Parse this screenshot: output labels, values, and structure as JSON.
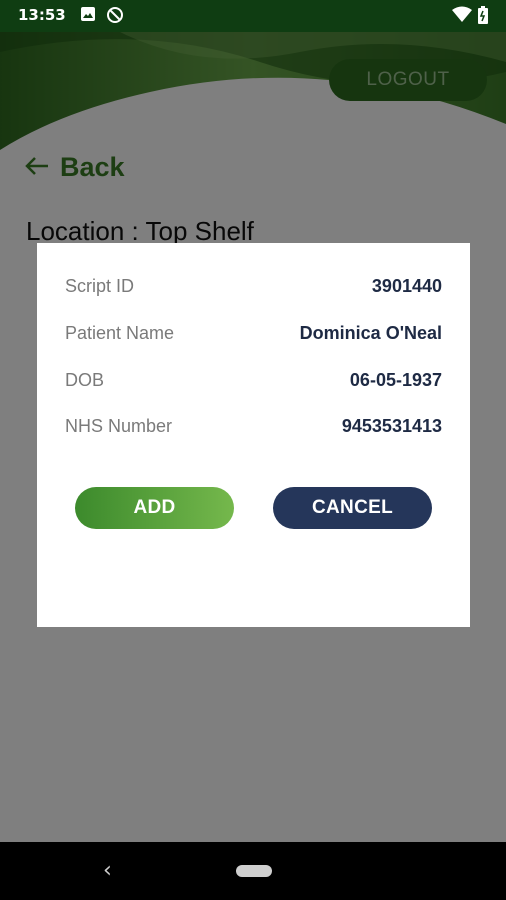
{
  "status_bar": {
    "time": "13:53",
    "icons": [
      "image-icon",
      "circle-slash-icon",
      "wifi-icon",
      "battery-icon"
    ]
  },
  "header": {
    "logout_label": "LOGOUT",
    "back_label": "Back",
    "location": "Location : Top Shelf"
  },
  "dialog": {
    "rows": [
      {
        "label": "Script ID",
        "value": "3901440"
      },
      {
        "label": "Patient Name",
        "value": "Dominica O'Neal"
      },
      {
        "label": "DOB",
        "value": "06-05-1937"
      },
      {
        "label": "NHS Number",
        "value": "9453531413"
      }
    ],
    "add_label": "ADD",
    "cancel_label": "CANCEL"
  },
  "colors": {
    "accent_green": "#3b7d26",
    "cancel_navy": "#25365a",
    "status_bar": "#0f3d12"
  }
}
